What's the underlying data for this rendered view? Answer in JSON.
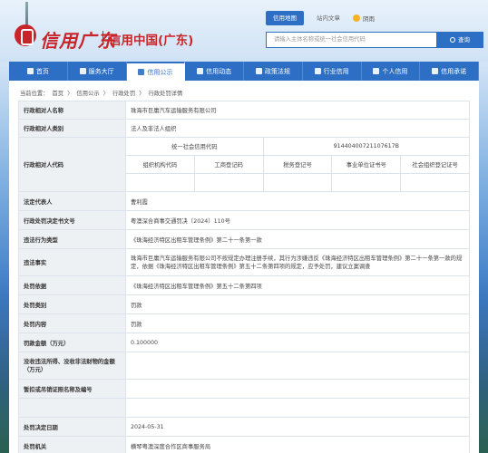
{
  "header": {
    "logo_script": "信用广东",
    "logo_text": "信用中国(广东)",
    "top_links": [
      "信用地图",
      "站内文章"
    ],
    "weather": "阴雨",
    "search": {
      "placeholder": "请输入主体名称或统一社会信用代码",
      "button": "查询"
    }
  },
  "nav": [
    {
      "label": "首页",
      "icon": "home-icon"
    },
    {
      "label": "服务大厅",
      "icon": "grid-icon"
    },
    {
      "label": "信用公示",
      "icon": "document-icon"
    },
    {
      "label": "信用动态",
      "icon": "news-icon"
    },
    {
      "label": "政策法规",
      "icon": "book-icon"
    },
    {
      "label": "行业信用",
      "icon": "building-icon"
    },
    {
      "label": "个人信用",
      "icon": "person-icon"
    },
    {
      "label": "信用承诺",
      "icon": "handshake-icon"
    }
  ],
  "breadcrumb": [
    "当前位置：",
    "首页",
    "〉",
    "信用公示",
    "〉",
    "行政处罚",
    "〉",
    "行政处罚详情"
  ],
  "detail": {
    "name_label": "行政相对人名称",
    "name": "珠海市巨庸汽车运输服务有限公司",
    "type_label": "行政相对人类别",
    "type": "法人及非法人组织",
    "code_label": "行政相对人代码",
    "code_headers_row1": [
      "统一社会信用代码",
      "91440400721107617B"
    ],
    "code_headers_row2": [
      "组织机构代码",
      "工商登记码",
      "税务登记号",
      "事业单位证书号",
      "社会组织登记证号"
    ],
    "rep_label": "法定代表人",
    "rep": "曹利霞",
    "doc_label": "行政处罚决定书文号",
    "doc": "粤澳深合商事交通罚决〔2024〕110号",
    "violation_label": "违法行为类型",
    "violation": "《珠海经济特区出租车管理条例》第二十一条第一款",
    "facts_label": "违法事实",
    "facts": "珠海市巨庸汽车运输服务有限公司不按规定办理注册手续，其行为涉嫌违反《珠海经济特区出租车管理条例》第二十一条第一款的规定，依据《珠海经济特区出租车管理条例》第五十二条第四项的规定，应予处罚，建议立案调查",
    "basis_label": "处罚依据",
    "basis": "《珠海经济特区出租车管理条例》第五十二条第四项",
    "category_label": "处罚类别",
    "category": "罚款",
    "content_label": "处罚内容",
    "content": "罚款",
    "amount_label": "罚款金额（万元）",
    "amount": "0.100000",
    "confiscated_label": "没收违法所得、没收非法财物的金额（万元）",
    "confiscated": "",
    "revoke_label": "暂扣或吊销证照名称及编号",
    "revoke": "",
    "date_label": "处罚决定日期",
    "date": "2024-05-31",
    "org_label": "处罚机关",
    "org": "横琴粤澳深度合作区商事服务局"
  }
}
